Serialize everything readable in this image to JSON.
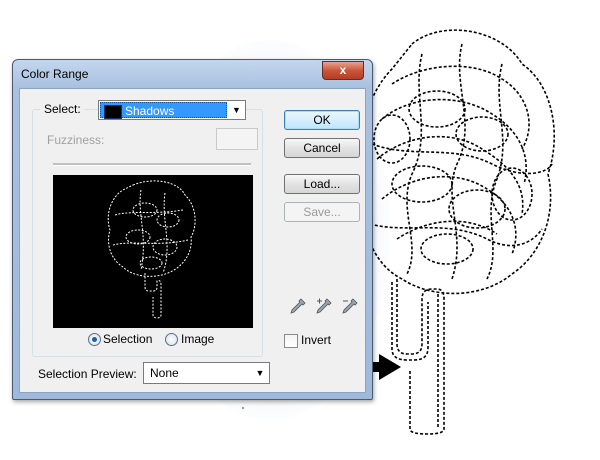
{
  "dialog": {
    "title": "Color Range",
    "close_label": "x",
    "select": {
      "label": "Select:",
      "value": "Shadows",
      "swatch_color": "#000000"
    },
    "fuzziness": {
      "label": "Fuzziness:",
      "value": ""
    },
    "view_mode": {
      "options": [
        {
          "label": "Selection",
          "checked": true
        },
        {
          "label": "Image",
          "checked": false
        }
      ]
    },
    "selection_preview": {
      "label": "Selection Preview:",
      "value": "None"
    },
    "buttons": {
      "ok": "OK",
      "cancel": "Cancel",
      "load": "Load...",
      "save": "Save..."
    },
    "eyedroppers": [
      "eyedropper-icon",
      "eyedropper-plus-icon",
      "eyedropper-minus-icon"
    ],
    "invert": {
      "label": "Invert",
      "checked": false
    }
  },
  "colors": {
    "accent_highlight": "#3399ff",
    "default_button": "#bde6fd",
    "close_button": "#c8563c"
  }
}
